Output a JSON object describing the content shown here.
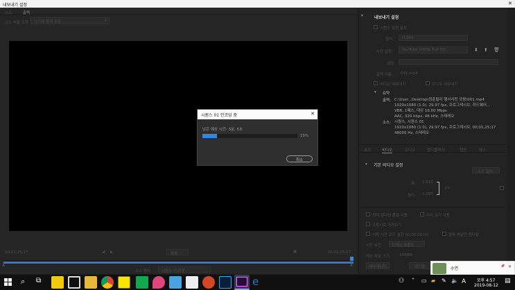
{
  "window": {
    "title": "내보내기 설정",
    "close_glyph": "✕"
  },
  "left": {
    "tabs": [
      "소스",
      "출력"
    ],
    "source_scaling_label": "소스 비율 조정",
    "source_scaling_value": "크기에 맞게 조정",
    "timecode_in": "00;01;25;17",
    "timecode_out": "00;01;25;17",
    "fit_value": "맞춤",
    "source_range_label": "소스 범위",
    "source_range_value": "시퀀스 인/아웃"
  },
  "right": {
    "export_settings_title": "내보내기 설정",
    "match_sequence_label": "시퀀스 설정 일치",
    "format_label": "형식:",
    "format_value": "H.264",
    "preset_label": "사전 설정:",
    "preset_value": "YouTube 1080p Full HD",
    "comments_label": "설명:",
    "output_name_label": "출력 이름:",
    "output_name_value": "001.mp4",
    "export_video_label": "비디오 내보내기",
    "export_audio_label": "오디오 내보내기",
    "summary_title": "요약",
    "output_label": "출력:",
    "output_lines": [
      "C:\\User...Desktop\\청춘릴리 행사사진 모음\\001.mp4",
      "1920x1080 (1.0), 29.97 fps, 프로그레시브, 하드웨어...",
      "VBR, 1패스, 대상 16.00 Mbps",
      "AAC, 320 kbps, 48 kHz, 스테레오"
    ],
    "source_label": "소스:",
    "source_lines": [
      "시퀀스, 시퀀스 01",
      "1920x1080 (1.0), 29.97 fps, 프로그레시브, 00;01;25;17",
      "48000 Hz, 스테레오"
    ],
    "tabs": [
      "효과",
      "비디오",
      "오디오",
      "멀티플렉서",
      "캡션",
      "게시"
    ],
    "basic_video_title": "기본 비디오 설정",
    "match_source_btn": "소스 일치",
    "width_label": "폭:",
    "width_value": "1,920",
    "height_label": "높이:",
    "height_value": "1,080",
    "px_unit": "px",
    "bottom_checkbox_1": "최대 렌더링 품질 사용",
    "bottom_checkbox_2": "미리 보기 사용",
    "bottom_checkbox_3": "프록시로 가져오기",
    "bottom_checkbox_4": "시작 시간 코드 설정 00;00;00;00",
    "bottom_checkbox_5": "알파 채널만 렌더링",
    "time_interp_label": "시간 보간:",
    "time_interp_value": "프레임 샘플링",
    "est_size_label": "예상 파일 크기:",
    "est_size_value": "169MB",
    "metadata_btn": "메타데이터...",
    "queue_btn": "대기열"
  },
  "dialog": {
    "title": "시퀀스 01 인코딩 중",
    "close_glyph": "✕",
    "remaining_label": "남은 예상 시간: 3분, 5초",
    "progress_percent": 15,
    "progress_text": "15%",
    "cancel_label": "취소"
  },
  "notification": {
    "name": "수연",
    "pin_glyph": "📌",
    "close_glyph": "✕"
  },
  "taskbar": {
    "clock_ampm_time": "오후 4:57",
    "clock_date": "2019-08-12",
    "ime_label": "A"
  }
}
